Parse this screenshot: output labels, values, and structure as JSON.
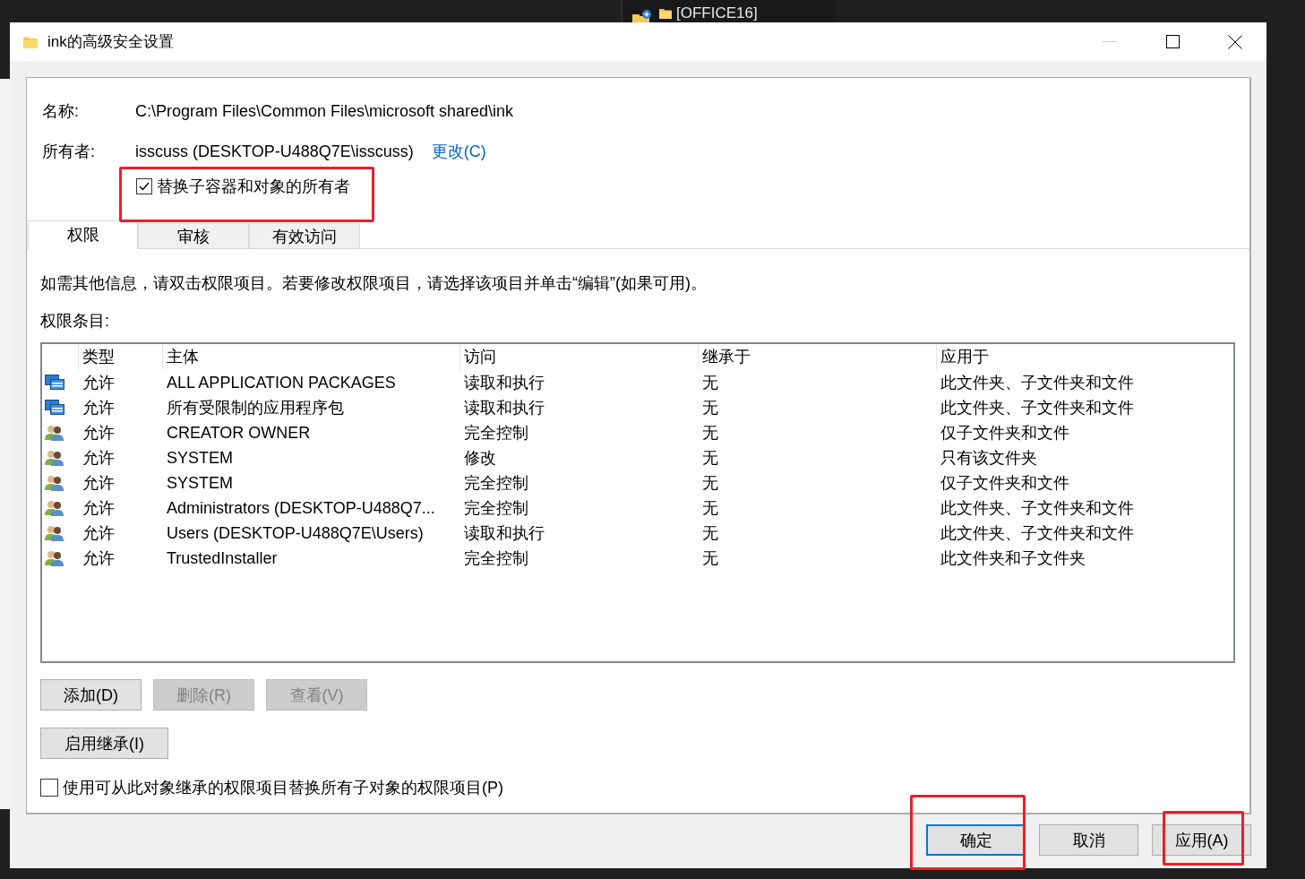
{
  "background_window": {
    "items": [
      "[OFFICE16]"
    ]
  },
  "window": {
    "title": "ink的高级安全设置"
  },
  "name": {
    "label": "名称:",
    "value": "C:\\Program Files\\Common Files\\microsoft shared\\ink"
  },
  "owner": {
    "label": "所有者:",
    "value": "isscuss (DESKTOP-U488Q7E\\isscuss)",
    "change_link": "更改(C)"
  },
  "replace_owner": {
    "label": "替换子容器和对象的所有者",
    "checked": true,
    "highlighted": true
  },
  "tabs": [
    {
      "label": "权限",
      "selected": true
    },
    {
      "label": "审核",
      "selected": false
    },
    {
      "label": "有效访问",
      "selected": false
    }
  ],
  "info_text": "如需其他信息，请双击权限项目。若要修改权限项目，请选择该项目并单击“编辑”(如果可用)。",
  "entries_label": "权限条目:",
  "table": {
    "columns": [
      "类型",
      "主体",
      "访问",
      "继承于",
      "应用于"
    ],
    "rows": [
      {
        "kind": "package",
        "cells": [
          "允许",
          "ALL APPLICATION PACKAGES",
          "读取和执行",
          "无",
          "此文件夹、子文件夹和文件"
        ]
      },
      {
        "kind": "package",
        "cells": [
          "允许",
          "所有受限制的应用程序包",
          "读取和执行",
          "无",
          "此文件夹、子文件夹和文件"
        ]
      },
      {
        "kind": "users",
        "cells": [
          "允许",
          "CREATOR OWNER",
          "完全控制",
          "无",
          "仅子文件夹和文件"
        ]
      },
      {
        "kind": "users",
        "cells": [
          "允许",
          "SYSTEM",
          "修改",
          "无",
          "只有该文件夹"
        ]
      },
      {
        "kind": "users",
        "cells": [
          "允许",
          "SYSTEM",
          "完全控制",
          "无",
          "仅子文件夹和文件"
        ]
      },
      {
        "kind": "users",
        "cells": [
          "允许",
          "Administrators (DESKTOP-U488Q7...",
          "完全控制",
          "无",
          "此文件夹、子文件夹和文件"
        ]
      },
      {
        "kind": "users",
        "cells": [
          "允许",
          "Users (DESKTOP-U488Q7E\\Users)",
          "读取和执行",
          "无",
          "此文件夹、子文件夹和文件"
        ]
      },
      {
        "kind": "users",
        "cells": [
          "允许",
          "TrustedInstaller",
          "完全控制",
          "无",
          "此文件夹和子文件夹"
        ]
      }
    ]
  },
  "entry_buttons": [
    {
      "label": "添加(D)",
      "disabled": false
    },
    {
      "label": "删除(R)",
      "disabled": true
    },
    {
      "label": "查看(V)",
      "disabled": true
    }
  ],
  "inheritance_button": {
    "label": "启用继承(I)",
    "disabled": false
  },
  "replace_child": {
    "label": "使用可从此对象继承的权限项目替换所有子对象的权限项目(P)",
    "checked": false
  },
  "footer_buttons": [
    {
      "label": "确定",
      "default": true,
      "highlighted": true
    },
    {
      "label": "取消",
      "default": false,
      "highlighted": false
    },
    {
      "label": "应用(A)",
      "default": false,
      "highlighted": true
    }
  ]
}
